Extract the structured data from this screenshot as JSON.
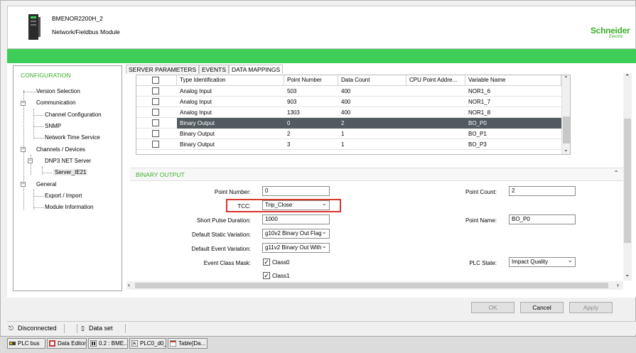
{
  "header": {
    "module_name": "BMENOR2200H_2",
    "module_type": "Network/Fieldbus Module",
    "logo": "Schneider",
    "logo_sub": "Electric"
  },
  "tree": {
    "title": "CONFIGURATION",
    "items": [
      {
        "label": "Version Selection"
      },
      {
        "label": "Communication"
      },
      {
        "label": "Channel Configuration"
      },
      {
        "label": "SNMP"
      },
      {
        "label": "Network Time Service"
      },
      {
        "label": "Channels / Devices"
      },
      {
        "label": "DNP3 NET Server"
      },
      {
        "label": "Server_IE21"
      },
      {
        "label": "General"
      },
      {
        "label": "Export / Import"
      },
      {
        "label": "Module Information"
      }
    ]
  },
  "tabs": [
    {
      "label": "SERVER PARAMETERS"
    },
    {
      "label": "EVENTS"
    },
    {
      "label": "DATA MAPPINGS"
    }
  ],
  "table": {
    "columns": [
      "Type Identification",
      "Point Number",
      "Data Count",
      "CPU Point Addre...",
      "Variable Name"
    ],
    "rows": [
      {
        "type": "Analog Input",
        "point": "503",
        "count": "400",
        "addr": "",
        "var": "NOR1_6",
        "selected": false
      },
      {
        "type": "Analog Input",
        "point": "903",
        "count": "400",
        "addr": "",
        "var": "NOR1_7",
        "selected": false
      },
      {
        "type": "Analog Input",
        "point": "1303",
        "count": "400",
        "addr": "",
        "var": "NOR1_8",
        "selected": false
      },
      {
        "type": "Binary Output",
        "point": "0",
        "count": "2",
        "addr": "",
        "var": "BO_P0",
        "selected": true
      },
      {
        "type": "Binary Output",
        "point": "2",
        "count": "1",
        "addr": "",
        "var": "BO_P1",
        "selected": false
      },
      {
        "type": "Binary Output",
        "point": "3",
        "count": "1",
        "addr": "",
        "var": "BO_P3",
        "selected": false
      }
    ]
  },
  "section": {
    "title": "BINARY OUTPUT",
    "point_number_label": "Point Number:",
    "point_number": "0",
    "tcc_label": "TCC:",
    "tcc": "Trip_Close",
    "short_pulse_label": "Short Pulse Duration:",
    "short_pulse": "1000",
    "static_var_label": "Default Static Variation:",
    "static_var": "g10v2 Binary Out Flag",
    "event_var_label": "Default Event Variation:",
    "event_var": "g11v2 Binary Out With",
    "event_class_label": "Event Class Mask:",
    "class0": "Class0",
    "class1": "Class1",
    "point_count_label": "Point Count:",
    "point_count": "2",
    "point_name_label": "Point Name:",
    "point_name": "BO_P0",
    "plc_state_label": "PLC State:",
    "plc_state": "Impact Quality"
  },
  "buttons": {
    "ok": "OK",
    "cancel": "Cancel",
    "apply": "Apply"
  },
  "status": {
    "connection": "Disconnected",
    "dataset": "Data set"
  },
  "taskbar": [
    {
      "label": "PLC bus"
    },
    {
      "label": "Data Editor"
    },
    {
      "label": "0.2 : BME..."
    },
    {
      "label": "PLC0_d0_..."
    },
    {
      "label": "Table[Da..."
    }
  ],
  "colors": {
    "brand_green": "#3dcd58",
    "selected_row": "#505a5f",
    "highlight_red": "#d9342b"
  }
}
